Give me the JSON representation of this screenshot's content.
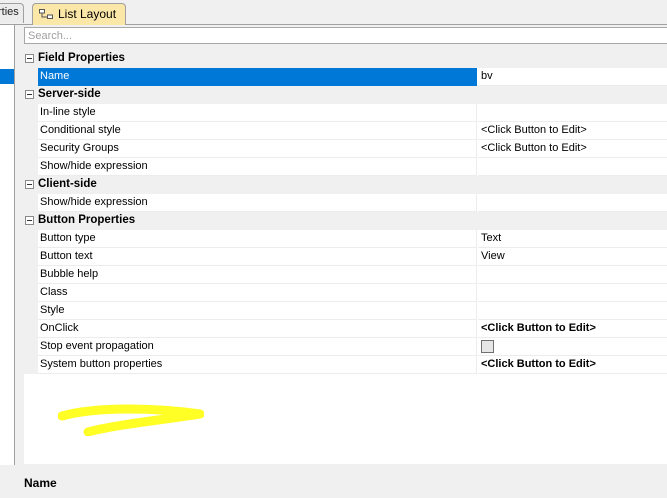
{
  "tabs": {
    "previous_label": "rties",
    "active_label": "List Layout",
    "active_icon": "list-layout-icon"
  },
  "search": {
    "placeholder": "Search..."
  },
  "grid": {
    "categories": [
      {
        "label": "Field Properties",
        "properties": [
          {
            "name": "Name",
            "value": "bv",
            "selected": true
          }
        ]
      },
      {
        "label": "Server-side",
        "properties": [
          {
            "name": "In-line style",
            "value": ""
          },
          {
            "name": "Conditional style",
            "value": "<Click Button to Edit>"
          },
          {
            "name": "Security Groups",
            "value": "<Click Button to Edit>"
          },
          {
            "name": "Show/hide expression",
            "value": ""
          }
        ]
      },
      {
        "label": "Client-side",
        "properties": [
          {
            "name": "Show/hide expression",
            "value": ""
          }
        ]
      },
      {
        "label": "Button Properties",
        "properties": [
          {
            "name": "Button type",
            "value": "Text"
          },
          {
            "name": "Button text",
            "value": "View"
          },
          {
            "name": "Bubble help",
            "value": ""
          },
          {
            "name": "Class",
            "value": ""
          },
          {
            "name": "Style",
            "value": ""
          },
          {
            "name": "OnClick",
            "value": "<Click Button to Edit>",
            "bold": true
          },
          {
            "name": "Stop event propagation",
            "value": "",
            "checked": false
          },
          {
            "name": "System button properties",
            "value": "<Click Button to Edit>",
            "bold": true
          }
        ]
      }
    ]
  },
  "highlight_color": "#ffff00",
  "selection_color": "#0078d7",
  "footer": {
    "description_title": "Name"
  }
}
